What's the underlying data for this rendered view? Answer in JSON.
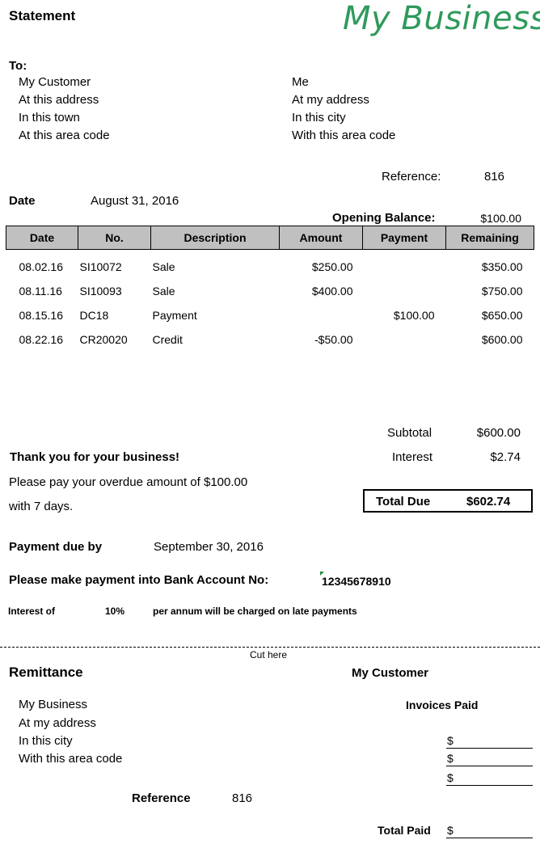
{
  "header": {
    "title": "Statement",
    "logo_text": "My Business"
  },
  "to": {
    "label": "To:",
    "customer": [
      "My Customer",
      "At this address",
      "In this town",
      "At this area code"
    ],
    "sender": [
      "Me",
      "At my address",
      "In this city",
      "With this area code"
    ]
  },
  "reference": {
    "label": "Reference:",
    "value": "816"
  },
  "date": {
    "label": "Date",
    "value": "August 31, 2016"
  },
  "opening_balance": {
    "label": "Opening Balance:",
    "value": "$100.00"
  },
  "table": {
    "headers": [
      "Date",
      "No.",
      "Description",
      "Amount",
      "Payment",
      "Remaining"
    ],
    "rows": [
      {
        "date": "08.02.16",
        "no": "SI10072",
        "description": "Sale",
        "amount": "$250.00",
        "payment": "",
        "remaining": "$350.00"
      },
      {
        "date": "08.11.16",
        "no": "SI10093",
        "description": "Sale",
        "amount": "$400.00",
        "payment": "",
        "remaining": "$750.00"
      },
      {
        "date": "08.15.16",
        "no": "DC18",
        "description": "Payment",
        "amount": "",
        "payment": "$100.00",
        "remaining": "$650.00"
      },
      {
        "date": "08.22.16",
        "no": "CR20020",
        "description": "Credit",
        "amount": "-$50.00",
        "payment": "",
        "remaining": "$600.00"
      }
    ]
  },
  "totals": {
    "subtotal_label": "Subtotal",
    "subtotal_value": "$600.00",
    "interest_label": "Interest",
    "interest_value": "$2.74",
    "total_label": "Total Due",
    "total_value": "$602.74"
  },
  "messages": {
    "thanks": "Thank you for your business!",
    "overdue_line1": "Please pay your overdue amount of $100.00",
    "overdue_line2": "with 7 days."
  },
  "payment_due": {
    "label": "Payment due by",
    "value": "September 30, 2016"
  },
  "bank": {
    "label": "Please make payment into Bank Account No:",
    "value": "12345678910"
  },
  "interest_note": {
    "prefix": "Interest of",
    "rate": "10%",
    "suffix": "per annum will be charged on late payments"
  },
  "cut_here": "Cut here",
  "remittance": {
    "title": "Remittance",
    "customer": "My Customer",
    "business": [
      "My Business",
      "At my address",
      "In this city",
      "With this area code"
    ],
    "invoices_paid_label": "Invoices Paid",
    "currency": "$",
    "reference_label": "Reference",
    "reference_value": "816",
    "total_paid_label": "Total Paid"
  }
}
